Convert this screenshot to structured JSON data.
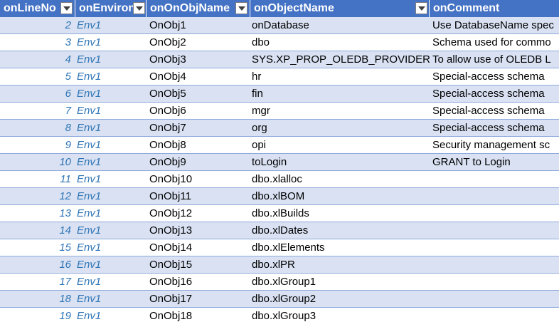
{
  "columns": [
    "onLineNo",
    "onEnviron",
    "onOnObjName",
    "onObjectName",
    "onComment"
  ],
  "colors": {
    "header_bg": "#4472c4",
    "band_bg": "#d9e1f2",
    "accent_text": "#2e75b6"
  },
  "rows": [
    {
      "line": "2",
      "env": "Env1",
      "obj": "OnObj1",
      "name": "onDatabase",
      "comment": "Use DatabaseName spec"
    },
    {
      "line": "3",
      "env": "Env1",
      "obj": "OnObj2",
      "name": "dbo",
      "comment": "Schema used for commo"
    },
    {
      "line": "4",
      "env": "Env1",
      "obj": "OnObj3",
      "name": "SYS.XP_PROP_OLEDB_PROVIDER",
      "comment": "To allow use of OLEDB L"
    },
    {
      "line": "5",
      "env": "Env1",
      "obj": "OnObj4",
      "name": "hr",
      "comment": "Special-access schema"
    },
    {
      "line": "6",
      "env": "Env1",
      "obj": "OnObj5",
      "name": "fin",
      "comment": "Special-access schema"
    },
    {
      "line": "7",
      "env": "Env1",
      "obj": "OnObj6",
      "name": "mgr",
      "comment": "Special-access schema"
    },
    {
      "line": "8",
      "env": "Env1",
      "obj": "OnObj7",
      "name": "org",
      "comment": "Special-access schema"
    },
    {
      "line": "9",
      "env": "Env1",
      "obj": "OnObj8",
      "name": "opi",
      "comment": "Security management sc"
    },
    {
      "line": "10",
      "env": "Env1",
      "obj": "OnObj9",
      "name": "toLogin",
      "comment": "GRANT to Login"
    },
    {
      "line": "11",
      "env": "Env1",
      "obj": "OnObj10",
      "name": "dbo.xlalloc",
      "comment": ""
    },
    {
      "line": "12",
      "env": "Env1",
      "obj": "OnObj11",
      "name": "dbo.xlBOM",
      "comment": ""
    },
    {
      "line": "13",
      "env": "Env1",
      "obj": "OnObj12",
      "name": "dbo.xlBuilds",
      "comment": ""
    },
    {
      "line": "14",
      "env": "Env1",
      "obj": "OnObj13",
      "name": "dbo.xlDates",
      "comment": ""
    },
    {
      "line": "15",
      "env": "Env1",
      "obj": "OnObj14",
      "name": "dbo.xlElements",
      "comment": ""
    },
    {
      "line": "16",
      "env": "Env1",
      "obj": "OnObj15",
      "name": "dbo.xlPR",
      "comment": ""
    },
    {
      "line": "17",
      "env": "Env1",
      "obj": "OnObj16",
      "name": "dbo.xlGroup1",
      "comment": ""
    },
    {
      "line": "18",
      "env": "Env1",
      "obj": "OnObj17",
      "name": "dbo.xlGroup2",
      "comment": ""
    },
    {
      "line": "19",
      "env": "Env1",
      "obj": "OnObj18",
      "name": "dbo.xlGroup3",
      "comment": ""
    }
  ]
}
